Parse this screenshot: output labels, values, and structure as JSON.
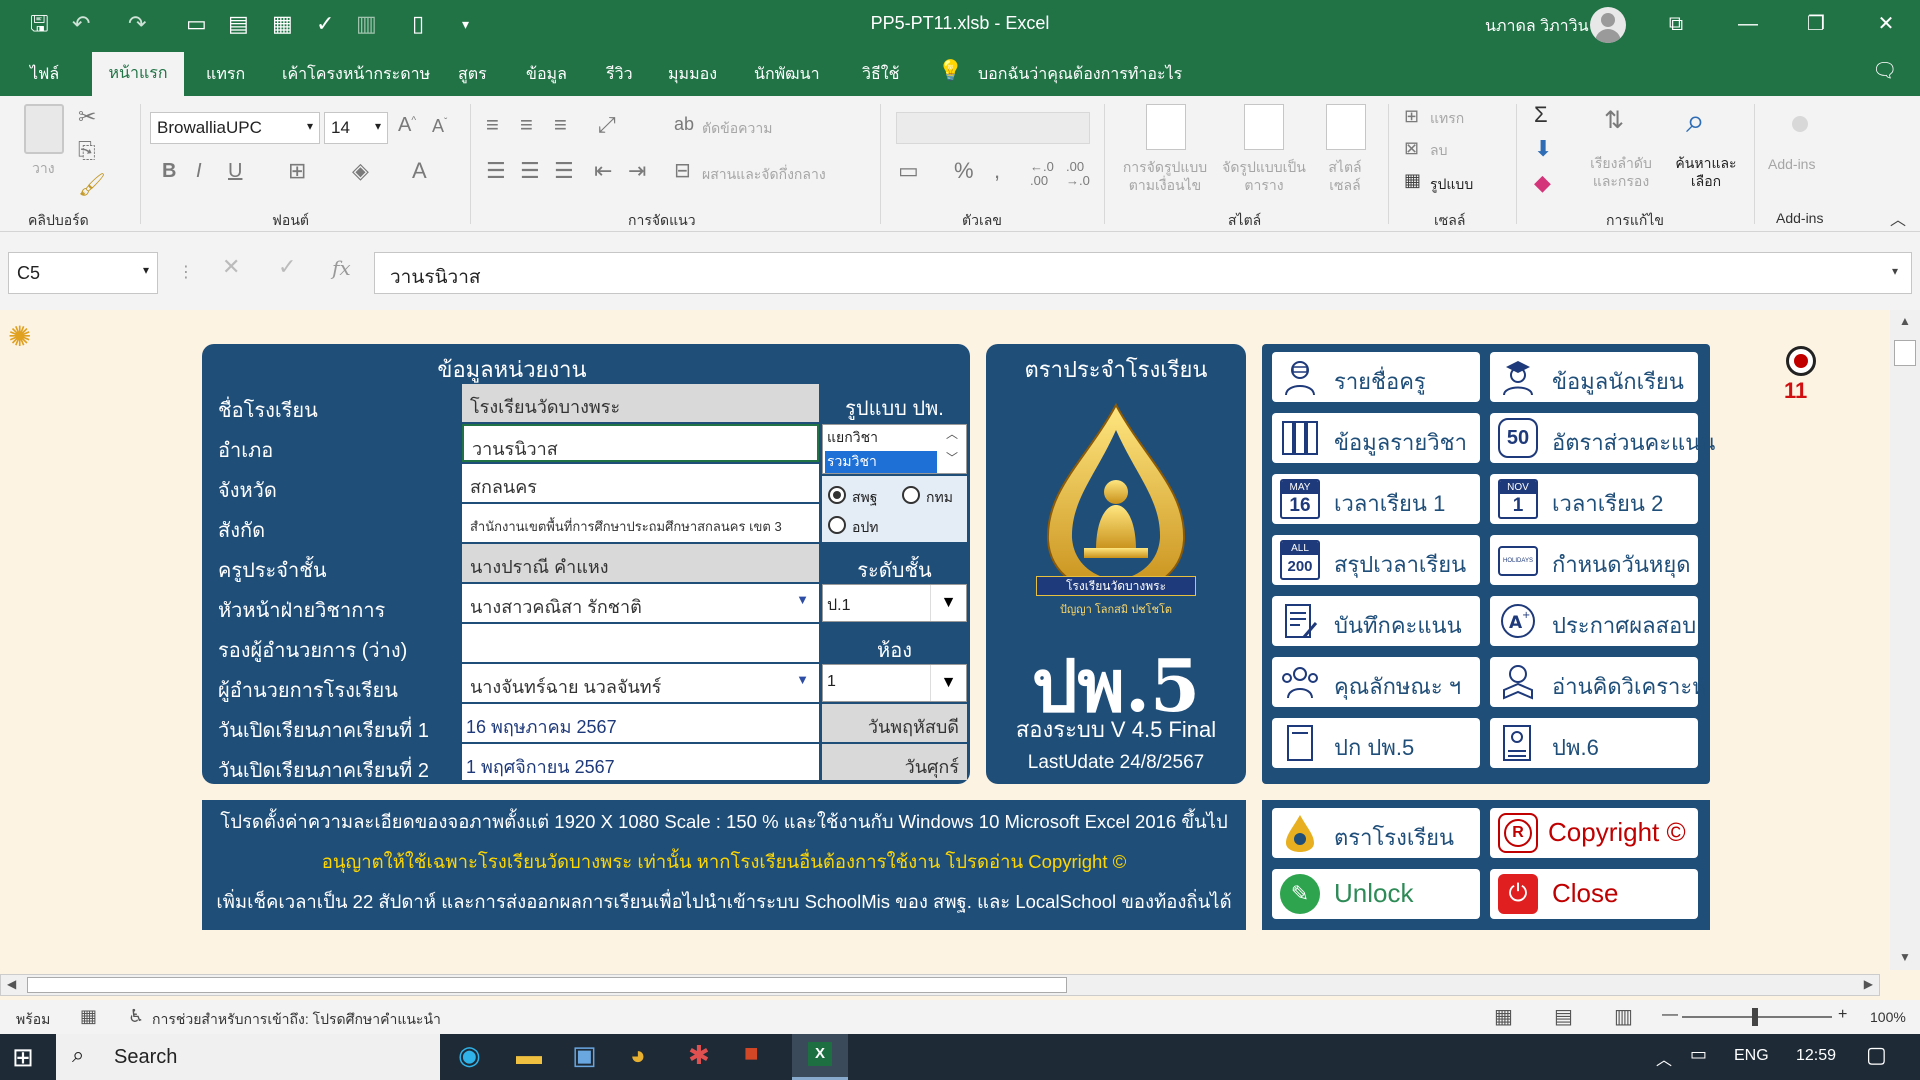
{
  "window": {
    "title": "PP5-PT11.xlsb  -  Excel",
    "user": "นภาดล วิภาวิน"
  },
  "menu": {
    "tabs": [
      "ไฟล์",
      "หน้าแรก",
      "แทรก",
      "เค้าโครงหน้ากระดาษ",
      "สูตร",
      "ข้อมูล",
      "รีวิว",
      "มุมมอง",
      "นักพัฒนา",
      "วิธีใช้"
    ],
    "tell_me": "บอกฉันว่าคุณต้องการทำอะไร"
  },
  "ribbon": {
    "font_name": "BrowalliaUPC",
    "font_size": "14",
    "groups": [
      "คลิปบอร์ด",
      "ฟอนต์",
      "การจัดแนว",
      "ตัวเลข",
      "สไตล์",
      "เซลล์",
      "การแก้ไข",
      "Add-ins"
    ],
    "paste": "วาง",
    "wrap_text": "ตัดข้อความ",
    "merge_center": "ผสานและจัดกึ่งกลาง",
    "conditional": "การจัดรูปแบบตามเงื่อนไข",
    "format_table": "จัดรูปแบบเป็นตาราง",
    "cell_style": "สไตล์เซลล์",
    "insert": "แทรก",
    "delete": "ลบ",
    "format": "รูปแบบ",
    "sort_filter": "เรียงลำดับและกรอง",
    "find_select": "ค้นหาและเลือก",
    "addins": "Add-ins"
  },
  "formula": {
    "namebox": "C5",
    "content": "วานรนิวาส"
  },
  "info": {
    "title": "ข้อมูลหน่วยงาน",
    "rows": [
      {
        "label": "ชื่อโรงเรียน",
        "value": "โรงเรียนวัดบางพระ"
      },
      {
        "label": "อำเภอ",
        "value": "วานรนิวาส"
      },
      {
        "label": "จังหวัด",
        "value": "สกลนคร"
      },
      {
        "label": "สังกัด",
        "value": "สำนักงานเขตพื้นที่การศึกษาประถมศึกษาสกลนคร เขต 3"
      },
      {
        "label": "ครูประจำชั้น",
        "value": "นางปราณี  คำแหง"
      },
      {
        "label": "หัวหน้าฝ่ายวิชาการ",
        "value": "นางสาวคณิสา รักชาติ"
      },
      {
        "label": "รองผู้อำนวยการ (ว่าง)",
        "value": ""
      },
      {
        "label": "ผู้อำนวยการโรงเรียน",
        "value": "นางจันทร์ฉาย นวลจันทร์"
      },
      {
        "label": "วันเปิดเรียนภาคเรียนที่ 1",
        "value": "16 พฤษภาคม 2567"
      },
      {
        "label": "วันเปิดเรียนภาคเรียนที่ 2",
        "value": "1 พฤศจิกายน 2567"
      }
    ],
    "format_label": "รูปแบบ ปพ.",
    "format_options": [
      "แยกวิชา",
      "รวมวิชา"
    ],
    "radio_options": [
      "สพฐ",
      "กทม",
      "อปท"
    ],
    "level_label": "ระดับชั้น",
    "level_value": "ป.1",
    "room_label": "ห้อง",
    "room_value": "1",
    "day1": "วันพฤหัสบดี",
    "day2": "วันศุกร์"
  },
  "logo_panel": {
    "title": "ตราประจำโรงเรียน",
    "seal_text": "โรงเรียนวัดบางพระ",
    "seal_motto": "ปัญญา โลกสมิ ปชโชโต",
    "main": "ปพ.5",
    "version": "สองระบบ V 4.5 Final",
    "update": "LastUdate 24/8/2567"
  },
  "menu_buttons": [
    {
      "label": "รายชื่อครู",
      "icon": "teacher-icon"
    },
    {
      "label": "ข้อมูลนักเรียน",
      "icon": "student-icon"
    },
    {
      "label": "ข้อมูลรายวิชา",
      "icon": "books-icon"
    },
    {
      "label": "อัตราส่วนคะแนน",
      "icon": "score-ratio-icon",
      "badge": "50"
    },
    {
      "label": "เวลาเรียน 1",
      "icon": "calendar-may-icon",
      "cal_month": "MAY",
      "cal_day": "16"
    },
    {
      "label": "เวลาเรียน 2",
      "icon": "calendar-nov-icon",
      "cal_month": "NOV",
      "cal_day": "1"
    },
    {
      "label": "สรุปเวลาเรียน",
      "icon": "calendar-all-icon",
      "cal_month": "ALL",
      "cal_day": "200"
    },
    {
      "label": "กำหนดวันหยุด",
      "icon": "holidays-icon",
      "badge": "HOLIDAYS"
    },
    {
      "label": "บันทึกคะแนน",
      "icon": "score-record-icon"
    },
    {
      "label": "ประกาศผลสอบ",
      "icon": "grade-icon"
    },
    {
      "label": "คุณลักษณะ ฯ",
      "icon": "characteristics-icon"
    },
    {
      "label": "อ่านคิดวิเคราะห์",
      "icon": "reading-icon"
    },
    {
      "label": "ปก ปพ.5",
      "icon": "cover-icon"
    },
    {
      "label": "ปพ.6",
      "icon": "report-icon"
    }
  ],
  "notice": {
    "line1": "โปรดตั้งค่าความละเอียดของจอภาพตั้งแต่ 1920 X 1080 Scale : 150 % และใช้งานกับ Windows 10 Microsoft Excel 2016 ขึ้นไป",
    "line2": "อนุญาตให้ใช้เฉพาะโรงเรียนวัดบางพระ เท่านั้น หากโรงเรียนอื่นต้องการใช้งาน โปรดอ่าน Copyright ©",
    "line3": "เพิ่มเช็คเวลาเป็น 22 สัปดาห์ และการส่งออกผลการเรียนเพื่อไปนำเข้าระบบ SchoolMis ของ สพฐ. และ LocalSchool ของท้องถิ่นได้"
  },
  "action_buttons": {
    "school_logo": "ตราโรงเรียน",
    "copyright": "Copyright ©",
    "unlock": "Unlock",
    "close": "Close"
  },
  "badge_number": "11",
  "status": {
    "ready": "พร้อม",
    "accessibility": "การช่วยสำหรับการเข้าถึง: โปรดศึกษาคำแนะนำ",
    "zoom": "100%"
  },
  "taskbar": {
    "search": "Search",
    "lang": "ENG",
    "time": "12:59"
  },
  "colors": {
    "excel_green": "#217346",
    "panel_blue": "#1f4e79",
    "sheet_bg": "#fdf3e3",
    "notice_yellow": "#ffd700"
  }
}
